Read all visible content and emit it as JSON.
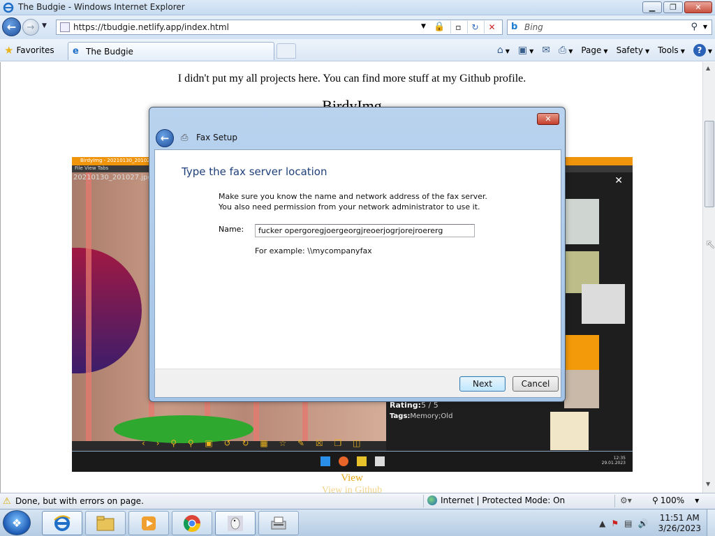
{
  "window": {
    "title": "The Budgie - Windows Internet Explorer",
    "minimize_glyph": "▁",
    "maximize_glyph": "❐",
    "close_glyph": "✕"
  },
  "nav": {
    "url": "https://tbudgie.netlify.app/index.html",
    "search_placeholder": "Bing"
  },
  "favorites": {
    "label": "Favorites",
    "tab_title": "The Budgie"
  },
  "commandbar": {
    "page": "Page",
    "safety": "Safety",
    "tools": "Tools",
    "help": "?"
  },
  "page": {
    "intro": "I didn't put my all projects here. You can find more stuff at my Github profile.",
    "project_title": "BirdyImg",
    "view_link": "View",
    "view_link2": "View in Github",
    "screenshot": {
      "title_bar": "BirdyImg - 20210130_201027.jpg",
      "menu": "File   View   Tabs",
      "filename": "20210130_201027.jpg",
      "rating_label": "Rating:",
      "rating_value": "5 / 5",
      "tags_label": "Tags:",
      "tags_value": "Memory;Old",
      "clock_time": "12:35",
      "clock_date": "29.01.2023"
    }
  },
  "dialog": {
    "title": "Fax Setup",
    "heading": "Type the fax server location",
    "desc_line1": "Make sure you know the name and network address of the fax server.",
    "desc_line2": "You also need permission from your network administrator to use it.",
    "name_label": "Name:",
    "name_value": "fucker opergoregjoergeorgjreoerjogrjorejroererg",
    "example": "For example: \\\\mycompanyfax",
    "next_button": "Next",
    "cancel_button": "Cancel"
  },
  "status": {
    "message": "Done, but with errors on page.",
    "zone": "Internet | Protected Mode: On",
    "zoom": "100%"
  },
  "taskbar": {
    "time": "11:51 AM",
    "date": "3/26/2023"
  },
  "colors": {
    "dialog_heading": "#1e3f7a",
    "link": "#e8a715",
    "screenshot_accent": "#f0940c"
  }
}
